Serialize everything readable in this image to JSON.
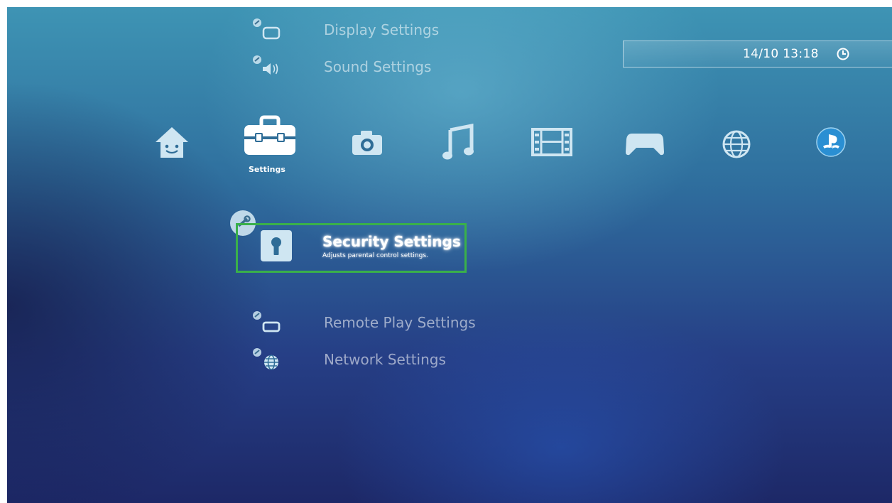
{
  "status_bar": {
    "datetime": "14/10 13:18",
    "clock_icon": "clock-icon"
  },
  "categories": [
    {
      "name": "Users",
      "icon": "user-icon"
    },
    {
      "name": "Settings",
      "icon": "toolbox-icon",
      "selected": true,
      "label": "Settings"
    },
    {
      "name": "Photo",
      "icon": "camera-icon"
    },
    {
      "name": "Music",
      "icon": "music-note-icon"
    },
    {
      "name": "Video",
      "icon": "film-strip-icon"
    },
    {
      "name": "Game",
      "icon": "gamepad-icon"
    },
    {
      "name": "Network",
      "icon": "globe-icon"
    },
    {
      "name": "PlayStation Network",
      "icon": "playstation-icon"
    }
  ],
  "settings_items": [
    {
      "label": "Display Settings",
      "icon": "display-settings-icon"
    },
    {
      "label": "Sound Settings",
      "icon": "sound-settings-icon"
    },
    {
      "label": "Security Settings",
      "description": "Adjusts parental control settings.",
      "icon": "keyhole-icon",
      "selected": true
    },
    {
      "label": "Remote Play Settings",
      "icon": "remote-play-settings-icon"
    },
    {
      "label": "Network Settings",
      "icon": "network-settings-icon"
    }
  ],
  "colors": {
    "selection_border": "#3ab04a",
    "icon_light": "#cfe6f2",
    "text_dim": "rgba(255,255,255,0.55)"
  }
}
